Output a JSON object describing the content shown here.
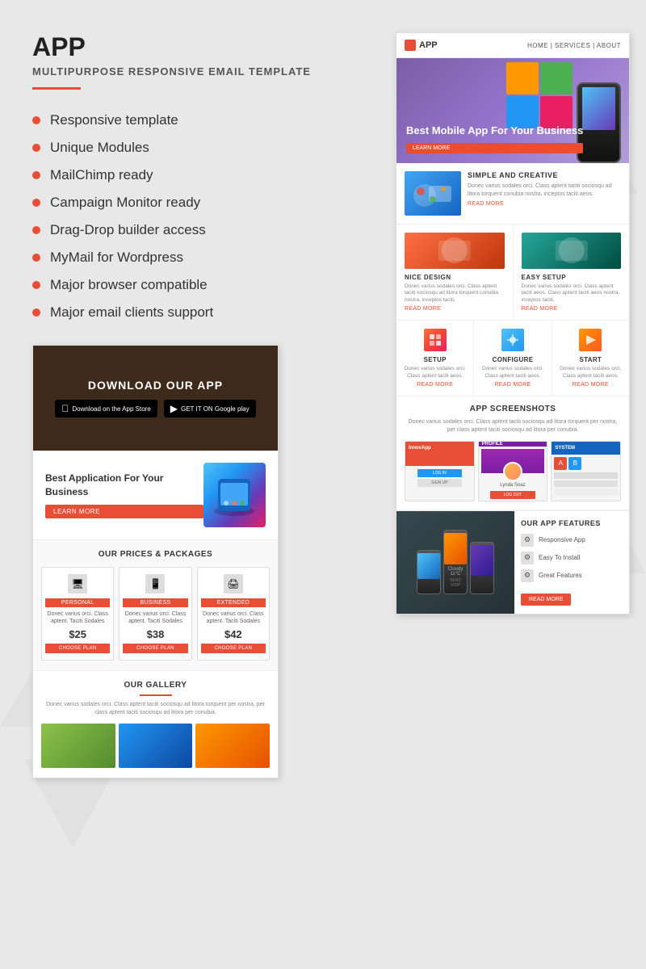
{
  "page": {
    "title": "APP",
    "subtitle": "MULTIPURPOSE RESPONSIVE EMAIL TEMPLATE"
  },
  "features": {
    "items": [
      "Responsive template",
      "Unique Modules",
      "MailChimp ready",
      "Campaign Monitor ready",
      "Drag-Drop builder access",
      "MyMail for Wordpress",
      "Major browser compatible",
      "Major email clients support"
    ]
  },
  "preview_left": {
    "download_title": "DOWNLOAD OUR APP",
    "appstore_label": "Download on the App Store",
    "googleplay_label": "GET IT ON Google play",
    "app_section_title": "Best Application For Your Business",
    "learn_more": "LEARN MORE",
    "pricing_title": "OUR PRICES & PACKAGES",
    "plans": [
      {
        "name": "PERSONAL",
        "price": "$25",
        "desc": "Donec varius orci. Class aptent. Taciti Sodales"
      },
      {
        "name": "BUSINESS",
        "price": "$38",
        "desc": "Donec varius orci. Class aptent. Taciti Sodales"
      },
      {
        "name": "EXTENDED",
        "price": "$42",
        "desc": "Donec varius orci. Class aptent. Taciti Sodales"
      }
    ],
    "choose_plan": "CHOOSE PLAN",
    "gallery_title": "OUR GALLERY",
    "gallery_desc": "Donec varius sodales orci. Class aptent taciti sociosqu ad litora torquent per nostra, per class aptent taciti sociosqu ad litora per conubia."
  },
  "preview_right": {
    "logo": "APP",
    "nav_links": "HOME | SERVICES | ABOUT",
    "hero_title": "Best Mobile App For Your Business",
    "hero_btn": "LEARN MORE",
    "feature_1": {
      "title": "SIMPLE AND CREATIVE",
      "desc": "Donec varius sodales orci. Class aptent taciti sociosqu ad litora torquent conubia nostra, inceptos taciti aeos.",
      "read_more": "READ MORE"
    },
    "feature_2": {
      "title": "NICE DESIGN",
      "desc": "Donec varius sodales orci. Class aptent taciti sociosqu ad litora torquent conubia nostra, inceptos taciti.",
      "read_more": "READ MORE"
    },
    "feature_3": {
      "title": "EASY SETUP",
      "desc": "Donec varius sodales orci. Class aptent taciti aeos. Class aptent taciti aeos nostra, inceptos taciti.",
      "read_more": "READ MORE"
    },
    "col_1": {
      "title": "SETUP",
      "desc": "Donec varius sodales orci. Class aptent taciti aeos.",
      "read_more": "READ MORE"
    },
    "col_2": {
      "title": "CONFIGURE",
      "desc": "Donec varius sodales orci. Class aptent taciti aeos.",
      "read_more": "READ MORE"
    },
    "col_3": {
      "title": "START",
      "desc": "Donec varius sodales orci. Class aptent taciti aeos.",
      "read_more": "READ MORE"
    },
    "screenshots_title": "APP SCREENSHOTS",
    "screenshots_desc": "Donec varius sodales orci. Class aptent taciti sociosqu ad litora torquent per nostra, per class aptent taciti sociosqu ad litora per conubia.",
    "profile_name": "Lynda Soaz",
    "login_btn": "LOG IN",
    "signup_btn": "SIGN UP",
    "logout_btn": "LOG OUT",
    "app_features_title": "OUR APP FEATURES",
    "app_features": [
      "Responsive App",
      "Easy To Install",
      "Great Features"
    ],
    "read_more": "READ MORE"
  }
}
